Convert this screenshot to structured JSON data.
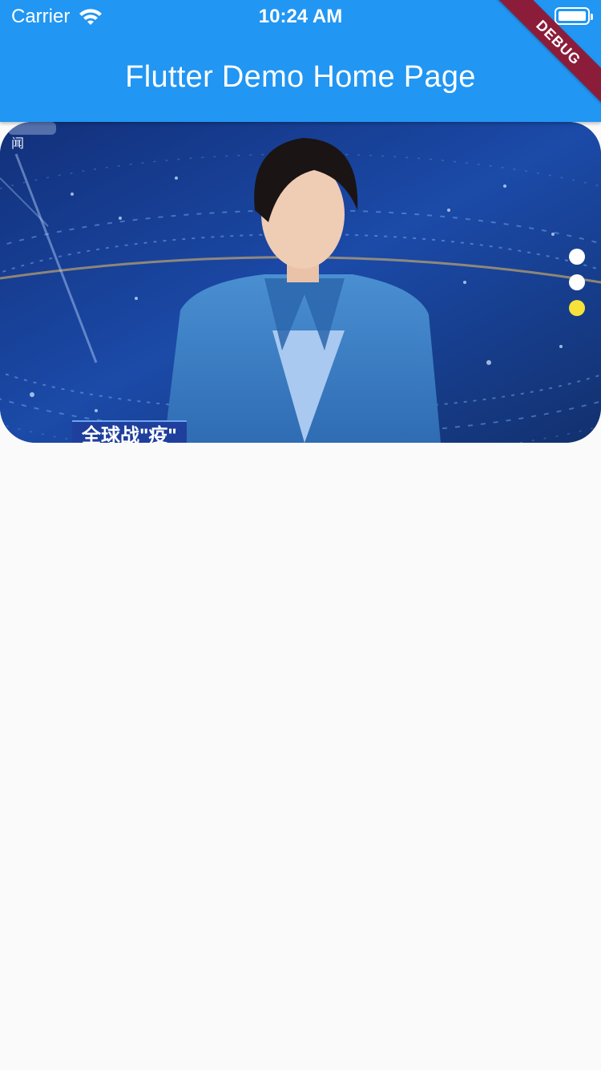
{
  "status_bar": {
    "carrier": "Carrier",
    "time": "10:24 AM"
  },
  "app_bar": {
    "title": "Flutter Demo Home Page",
    "debug_label": "DEBUG"
  },
  "banner": {
    "caption": "全球战\"疫\"",
    "corner_logo": "闻",
    "active_index": 2,
    "indicator_count": 3,
    "colors": {
      "active_dot": "#f7e23a",
      "inactive_dot": "#ffffff"
    }
  },
  "colors": {
    "app_bar": "#2196f3",
    "background": "#fafafa"
  }
}
